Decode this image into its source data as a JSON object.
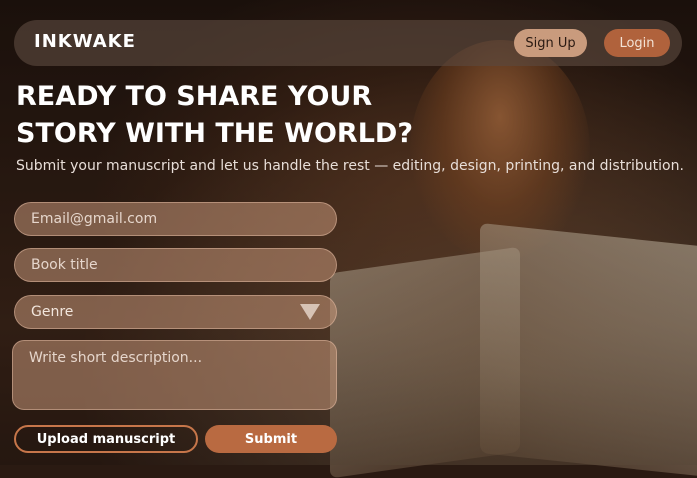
{
  "brand": {
    "name": "INKWAKE"
  },
  "nav": {
    "signup_label": "Sign Up",
    "login_label": "Login"
  },
  "hero": {
    "headline_line1": "READY TO SHARE YOUR",
    "headline_line2": "STORY WITH THE WORLD?",
    "subtext": "Submit your manuscript and let us handle the rest — editing, design, printing, and distribution."
  },
  "form": {
    "email_placeholder": "Email@gmail.com",
    "title_placeholder": "Book title",
    "genre_value": "Genre",
    "description_placeholder": "Write short description...",
    "upload_label": "Upload manuscript",
    "submit_label": "Submit"
  },
  "icons": {
    "genre_dropdown": "chevron-down-icon"
  },
  "colors": {
    "accent": "#b96a41",
    "signup_bg": "#c99b7d",
    "field_bg": "#c4967a"
  }
}
